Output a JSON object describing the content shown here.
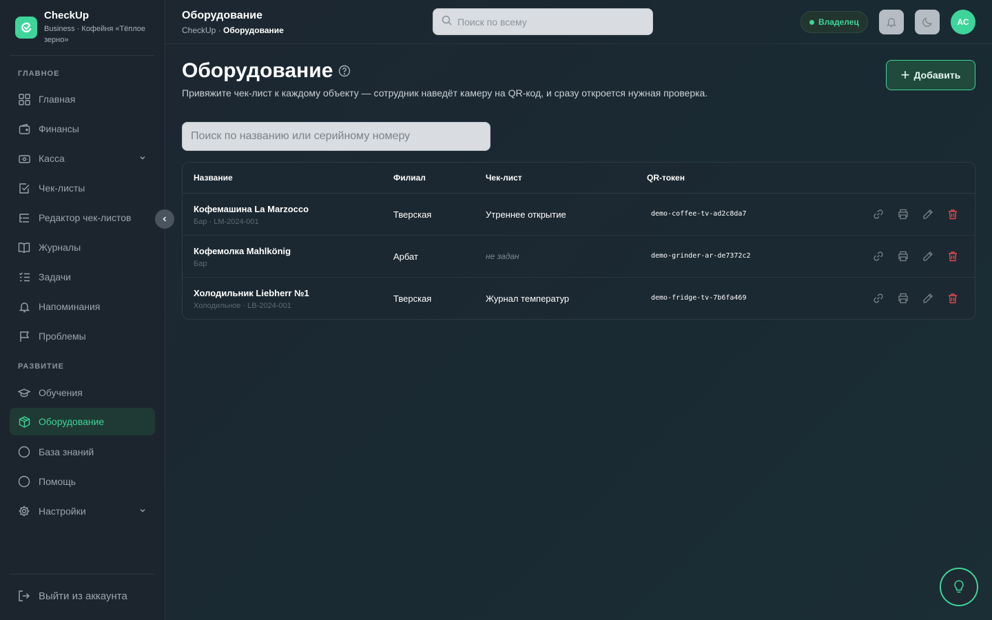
{
  "brand": {
    "name": "CheckUp",
    "subtitle": "Business · Кофейня «Тёплое зерно»"
  },
  "sidebar": {
    "sections": [
      {
        "label": "ГЛАВНОЕ"
      },
      {
        "label": "РАЗВИТИЕ"
      }
    ],
    "items": [
      {
        "label": "Главная",
        "icon": "grid-icon"
      },
      {
        "label": "Финансы",
        "icon": "wallet-icon"
      },
      {
        "label": "Касса",
        "icon": "cash-register-icon",
        "expandable": true
      },
      {
        "label": "Чек-листы",
        "icon": "checkbox-icon"
      },
      {
        "label": "Редактор чек-листов",
        "icon": "list-tree-icon"
      },
      {
        "label": "Журналы",
        "icon": "book-icon"
      },
      {
        "label": "Задачи",
        "icon": "task-list-icon"
      },
      {
        "label": "Напоминания",
        "icon": "bell-icon"
      },
      {
        "label": "Проблемы",
        "icon": "flag-icon"
      },
      {
        "label": "Обучения",
        "icon": "graduation-cap-icon"
      },
      {
        "label": "Оборудование",
        "icon": "box-icon",
        "active": true
      },
      {
        "label": "База знаний",
        "icon": "circle-icon"
      },
      {
        "label": "Помощь",
        "icon": "circle-icon"
      },
      {
        "label": "Настройки",
        "icon": "gear-icon",
        "expandable": true
      }
    ],
    "logout_label": "Выйти из аккаунта"
  },
  "header": {
    "title": "Оборудование",
    "crumb_root": "CheckUp",
    "crumb_sep": " · ",
    "crumb_current": "Оборудование",
    "search_placeholder": "Поиск по всему",
    "role_label": "Владелец",
    "avatar_initials": "АС"
  },
  "main": {
    "title": "Оборудование",
    "description": "Привяжите чек-лист к каждому объекту — сотрудник наведёт камеру на QR-код, и сразу откроется нужная проверка.",
    "add_label": "Добавить",
    "search_placeholder": "Поиск по названию или серийному номеру",
    "columns": {
      "name": "Название",
      "branch": "Филиал",
      "checklist": "Чек-лист",
      "token": "QR-токен"
    },
    "rows": [
      {
        "name": "Кофемашина La Marzocco",
        "meta": "Бар · LM-2024-001",
        "branch": "Тверская",
        "checklist": "Утреннее открытие",
        "checklist_missing": false,
        "token": "demo-coffee-tv-ad2c8da7"
      },
      {
        "name": "Кофемолка Mahlkönig",
        "meta": "Бар",
        "branch": "Арбат",
        "checklist": "не задан",
        "checklist_missing": true,
        "token": "demo-grinder-ar-de7372c2"
      },
      {
        "name": "Холодильник Liebherr №1",
        "meta": "Холодильное · LB-2024-001",
        "branch": "Тверская",
        "checklist": "Журнал температур",
        "checklist_missing": false,
        "token": "demo-fridge-tv-7b6fa469"
      }
    ]
  },
  "colors": {
    "accent": "#3dd599",
    "danger": "#e5484d",
    "background": "#1d2630"
  }
}
